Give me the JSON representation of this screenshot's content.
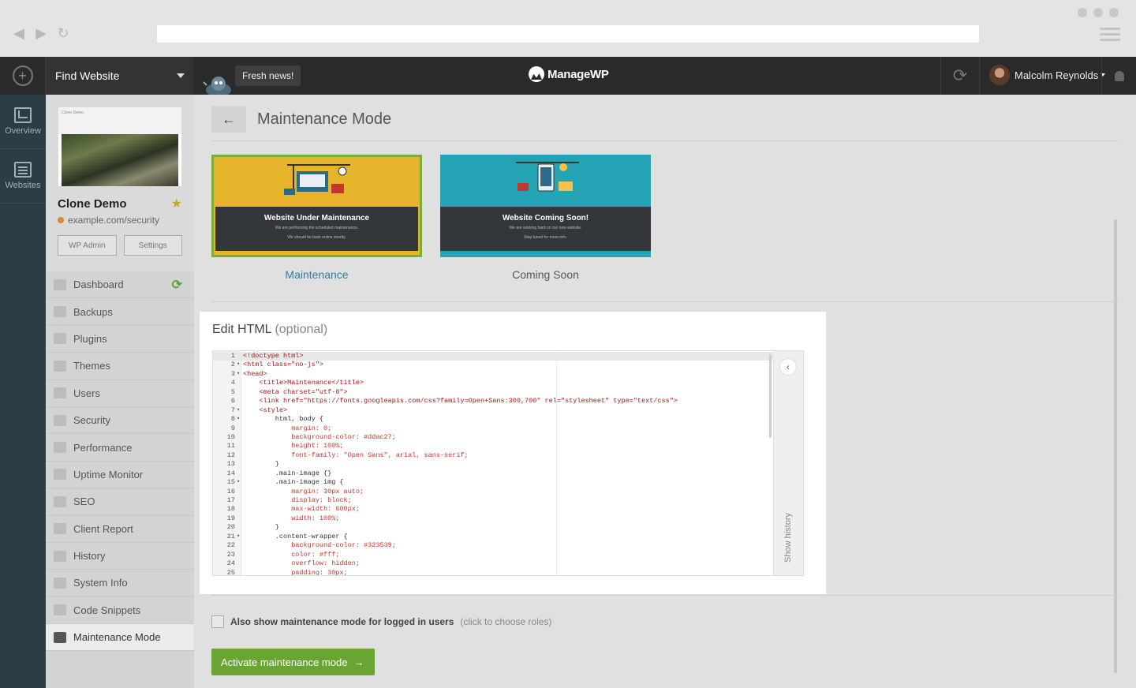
{
  "topbar": {
    "find_label": "Find Website",
    "fresh_news": "Fresh news!",
    "logo_text": "ManageWP",
    "user_name": "Malcolm Reynolds"
  },
  "rail": [
    {
      "label": "Overview",
      "icon": "chart-monitor-icon"
    },
    {
      "label": "Websites",
      "icon": "list-icon"
    }
  ],
  "site": {
    "thumb_title": "Clone Demo",
    "name": "Clone Demo",
    "url": "example.com/security",
    "wp_admin": "WP Admin",
    "settings": "Settings",
    "favorite": true
  },
  "menu": [
    {
      "label": "Dashboard",
      "icon": "monitor-icon",
      "refresh": true
    },
    {
      "label": "Backups",
      "icon": "backup-icon"
    },
    {
      "label": "Plugins",
      "icon": "plug-icon"
    },
    {
      "label": "Themes",
      "icon": "palette-icon"
    },
    {
      "label": "Users",
      "icon": "user-icon"
    },
    {
      "label": "Security",
      "icon": "shield-icon"
    },
    {
      "label": "Performance",
      "icon": "gauge-icon"
    },
    {
      "label": "Uptime Monitor",
      "icon": "arrow-up-icon"
    },
    {
      "label": "SEO",
      "icon": "megaphone-icon"
    },
    {
      "label": "Client Report",
      "icon": "report-icon"
    },
    {
      "label": "History",
      "icon": "clock-icon"
    },
    {
      "label": "System Info",
      "icon": "server-icon"
    },
    {
      "label": "Code Snippets",
      "icon": "code-icon"
    },
    {
      "label": "Maintenance Mode",
      "icon": "barrier-icon",
      "active": true
    }
  ],
  "main": {
    "title": "Maintenance Mode",
    "templates": [
      {
        "label": "Maintenance",
        "heading": "Website Under Maintenance",
        "sub1": "We are performing the scheduled maintenance.",
        "sub2": "We should be back online shortly.",
        "selected": true,
        "color": "#e6b42a"
      },
      {
        "label": "Coming Soon",
        "heading": "Website Coming Soon!",
        "sub1": "We are working hard on our new website.",
        "sub2": "Stay tuned for more info.",
        "selected": false,
        "color": "#23a3b3"
      }
    ],
    "editor_title": "Edit HTML",
    "editor_optional": "(optional)",
    "show_history": "Show history",
    "checkbox_label": "Also show maintenance mode for logged in users",
    "checkbox_hint": "(click to choose roles)",
    "checkbox_checked": false,
    "activate_label": "Activate maintenance mode",
    "accent_green": "#6aa534"
  },
  "code": [
    {
      "n": "1",
      "fold": "",
      "t": "<!doctype html>"
    },
    {
      "n": "2",
      "fold": "▾",
      "t": "<html class=\"no-js\">"
    },
    {
      "n": "3",
      "fold": "▾",
      "t": "<head>"
    },
    {
      "n": "4",
      "fold": "",
      "t": "    <title>Maintenance</title>"
    },
    {
      "n": "5",
      "fold": "",
      "t": "    <meta charset=\"utf-8\">"
    },
    {
      "n": "6",
      "fold": "",
      "t": "    <link href=\"https://fonts.googleapis.com/css?family=Open+Sans:300,700\" rel=\"stylesheet\" type=\"text/css\">"
    },
    {
      "n": "7",
      "fold": "▾",
      "t": "    <style>"
    },
    {
      "n": "8",
      "fold": "▾",
      "t": "        html, body {"
    },
    {
      "n": "9",
      "fold": "",
      "t": "            margin: 0;"
    },
    {
      "n": "10",
      "fold": "",
      "t": "            background-color: #ddac27;"
    },
    {
      "n": "11",
      "fold": "",
      "t": "            height: 100%;"
    },
    {
      "n": "12",
      "fold": "",
      "t": "            font-family: \"Open Sans\", arial, sans-serif;"
    },
    {
      "n": "13",
      "fold": "",
      "t": "        }"
    },
    {
      "n": "14",
      "fold": "",
      "t": "        .main-image {}"
    },
    {
      "n": "15",
      "fold": "▾",
      "t": "        .main-image img {"
    },
    {
      "n": "16",
      "fold": "",
      "t": "            margin: 30px auto;"
    },
    {
      "n": "17",
      "fold": "",
      "t": "            display: block;"
    },
    {
      "n": "18",
      "fold": "",
      "t": "            max-width: 600px;"
    },
    {
      "n": "19",
      "fold": "",
      "t": "            width: 100%;"
    },
    {
      "n": "20",
      "fold": "",
      "t": "        }"
    },
    {
      "n": "21",
      "fold": "▾",
      "t": "        .content-wrapper {"
    },
    {
      "n": "22",
      "fold": "",
      "t": "            background-color: #323539;"
    },
    {
      "n": "23",
      "fold": "",
      "t": "            color: #fff;"
    },
    {
      "n": "24",
      "fold": "",
      "t": "            overflow: hidden;"
    },
    {
      "n": "25",
      "fold": "",
      "t": "            padding: 30px;"
    }
  ]
}
